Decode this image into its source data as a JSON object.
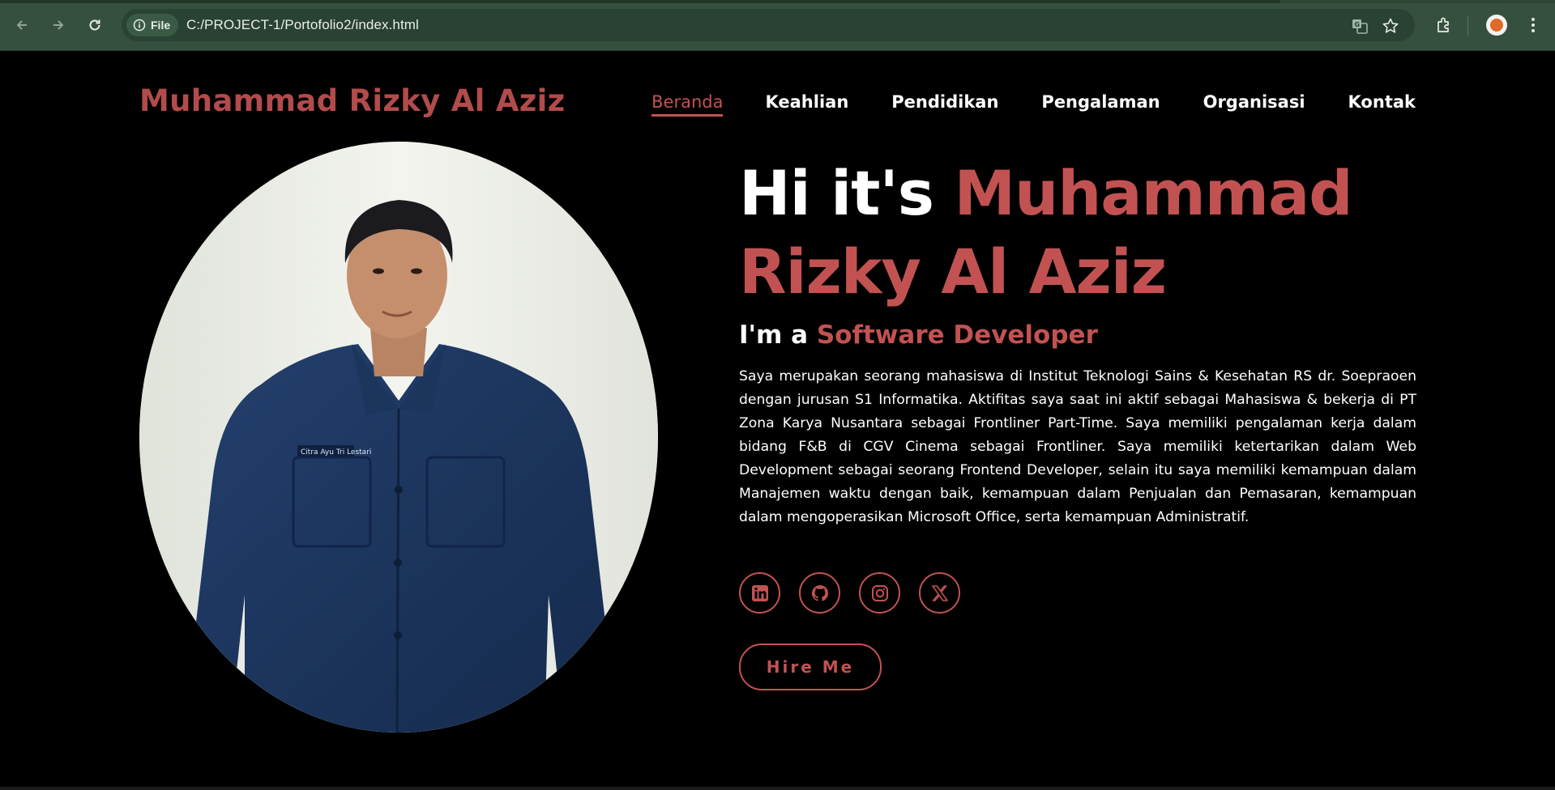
{
  "browser": {
    "url": "C:/PROJECT-1/Portofolio2/index.html",
    "file_label": "File",
    "icons": [
      "back-icon",
      "forward-icon",
      "reload-icon",
      "info-icon",
      "translate-icon",
      "star-icon",
      "extensions-icon",
      "profile-avatar",
      "menu-icon"
    ]
  },
  "header": {
    "brand": "Muhammad Rizky Al Aziz",
    "nav": [
      {
        "label": "Beranda",
        "active": true
      },
      {
        "label": "Keahlian",
        "active": false
      },
      {
        "label": "Pendidikan",
        "active": false
      },
      {
        "label": "Pengalaman",
        "active": false
      },
      {
        "label": "Organisasi",
        "active": false
      },
      {
        "label": "Kontak",
        "active": false
      }
    ]
  },
  "hero": {
    "greeting_prefix": "Hi it's",
    "name_line1": "Muhammad",
    "name_line2": "Rizky Al Aziz",
    "role_prefix": "I'm a",
    "role": "Software Developer",
    "description": "Saya merupakan seorang mahasiswa di Institut Teknologi Sains & Kesehatan RS dr. Soepraoen dengan jurusan S1 Informatika. Aktifitas saya saat ini aktif sebagai Mahasiswa & bekerja di PT Zona Karya Nusantara sebagai Frontliner Part-Time. Saya memiliki pengalaman kerja dalam bidang F&B di CGV Cinema sebagai Frontliner. Saya memiliki ketertarikan dalam Web Development sebagai seorang Frontend Developer, selain itu saya memiliki kemampuan dalam Manajemen waktu dengan baik, kemampuan dalam Penjualan dan Pemasaran, kemampuan dalam mengoperasikan Microsoft Office, serta kemampuan Administratif.",
    "socials": [
      "linkedin-icon",
      "github-icon",
      "instagram-icon",
      "x-icon"
    ],
    "cta": "Hire Me",
    "badge_text": "Citra Ayu Tri Lestari"
  },
  "colors": {
    "accent": "#c25252",
    "background": "#000000",
    "browser_chrome": "#35503f"
  }
}
